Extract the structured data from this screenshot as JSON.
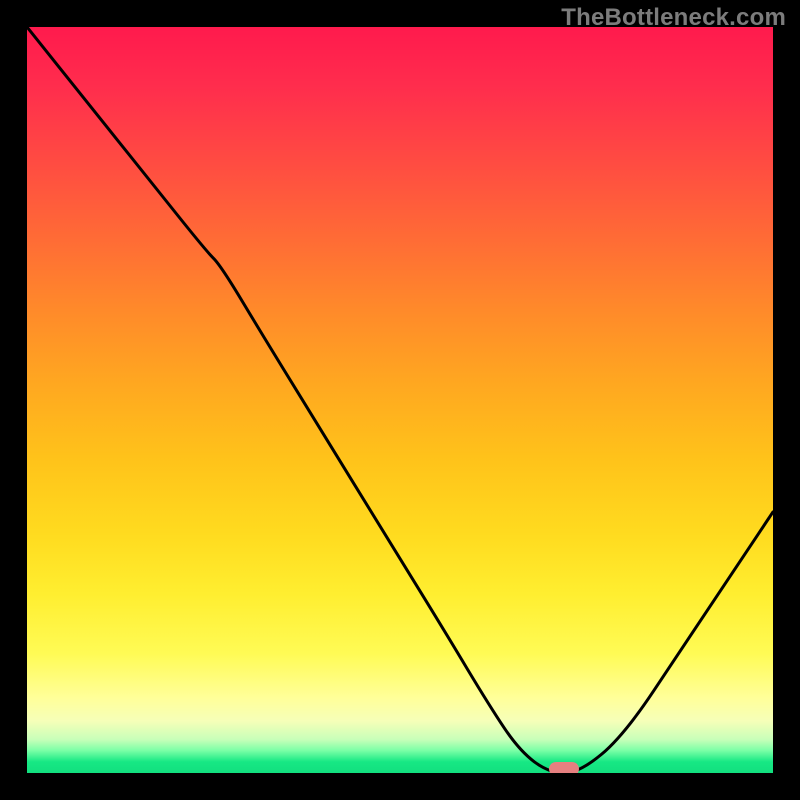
{
  "watermark": "TheBottleneck.com",
  "chart_data": {
    "type": "line",
    "title": "",
    "xlabel": "",
    "ylabel": "",
    "xlim": [
      0,
      100
    ],
    "ylim": [
      0,
      100
    ],
    "series": [
      {
        "name": "bottleneck-curve",
        "x": [
          0,
          8,
          16,
          24,
          26,
          32,
          40,
          48,
          56,
          62,
          66,
          70,
          74,
          80,
          88,
          96,
          100
        ],
        "y": [
          100,
          90,
          80,
          70,
          68,
          58,
          45,
          32,
          19,
          9,
          3,
          0,
          0,
          5,
          17,
          29,
          35
        ]
      }
    ],
    "marker": {
      "x": 72,
      "y": 0,
      "color": "#e68080"
    },
    "gradient_colors": {
      "top": "#ff1a4d",
      "mid": "#ffd21f",
      "bottom": "#12df7f"
    }
  }
}
